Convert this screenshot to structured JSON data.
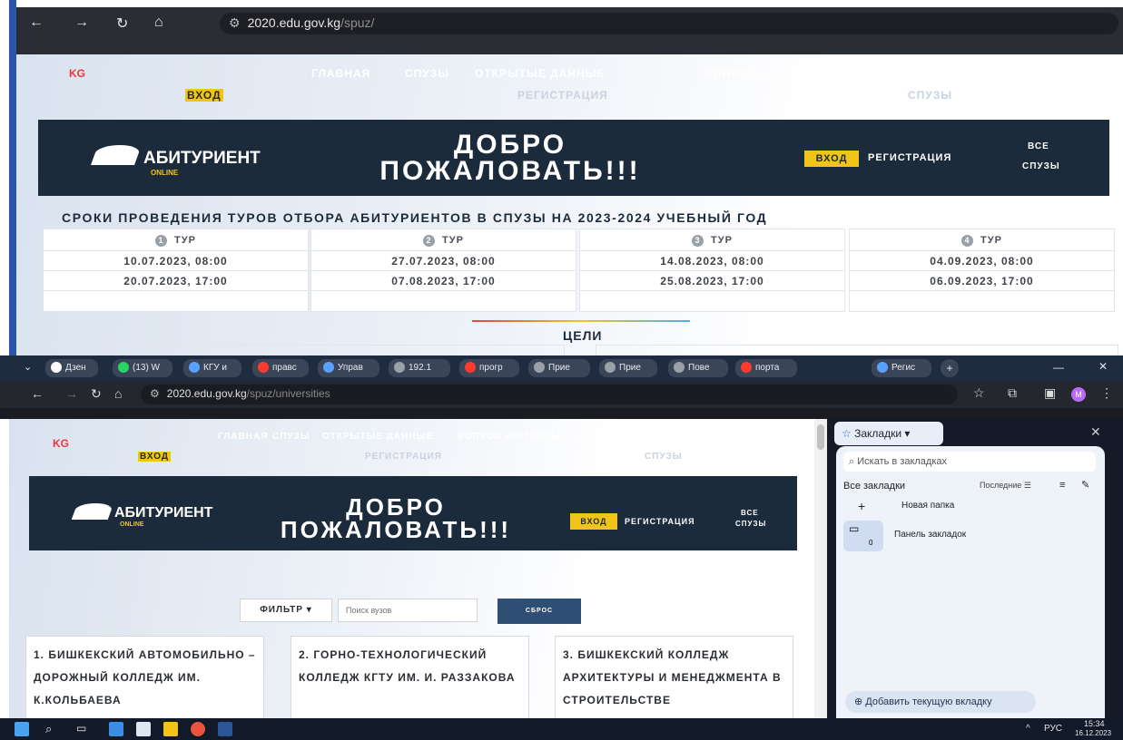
{
  "top": {
    "url_domain": "2020.edu.gov.kg",
    "url_path": "/spuz/",
    "brand": "KG",
    "nav": [
      "ГЛАВНАЯ",
      "СПУЗЫ",
      "ОТКРЫТЫЕ ДАННЫЕ",
      "ВОПРОСЫ/ОТВЕТЫ",
      "РЕГИСТРАЦИЯ",
      "ВХОД"
    ],
    "subnav": {
      "vhod": "ВХОД",
      "reg": "РЕГИСТРАЦИЯ",
      "spuzy": "СПУЗЫ"
    },
    "hero": {
      "logo": "АБИТУРИЕНТ",
      "logo_sub": "ONLINE",
      "welcome_1": "ДОБРО",
      "welcome_2": "ПОЖАЛОВАТЬ!!!",
      "btn_vhod": "ВХОД",
      "link_reg": "РЕГИСТРАЦИЯ",
      "link_all_1": "ВСЕ",
      "link_all_2": "СПУЗЫ"
    },
    "section_title": "СРОКИ ПРОВЕДЕНИЯ ТУРОВ ОТБОРА АБИТУРИЕНТОВ В СПУЗЫ НА 2023-2024 УЧЕБНЫЙ ГОД",
    "tours": [
      {
        "num": "1",
        "label": "ТУР",
        "start": "10.07.2023, 08:00",
        "end": "20.07.2023, 17:00"
      },
      {
        "num": "2",
        "label": "ТУР",
        "start": "27.07.2023, 08:00",
        "end": "07.08.2023, 17:00"
      },
      {
        "num": "3",
        "label": "ТУР",
        "start": "14.08.2023, 08:00",
        "end": "25.08.2023, 17:00"
      },
      {
        "num": "4",
        "label": "ТУР",
        "start": "04.09.2023, 08:00",
        "end": "06.09.2023, 17:00"
      }
    ],
    "goals": "ЦЕЛИ"
  },
  "tabs": [
    {
      "label": "Дзен",
      "color": "#ffffff"
    },
    {
      "label": "(13) W",
      "color": "#25d366"
    },
    {
      "label": "КГУ и",
      "color": "#5aa0ff"
    },
    {
      "label": "правс",
      "color": "#ff3b30"
    },
    {
      "label": "Управ",
      "color": "#5aa0ff"
    },
    {
      "label": "192.1",
      "color": "#9aa0a8"
    },
    {
      "label": "прогр",
      "color": "#ff3b30"
    },
    {
      "label": "Прие",
      "color": "#9aa0a8"
    },
    {
      "label": "Прие",
      "color": "#9aa0a8"
    },
    {
      "label": "Пове",
      "color": "#9aa0a8"
    },
    {
      "label": "порта",
      "color": "#ff3b30"
    },
    {
      "label": "Регис",
      "color": "#5aa0ff"
    }
  ],
  "bottom": {
    "url_domain": "2020.edu.gov.kg",
    "url_path": "/spuz/universities",
    "brand": "KG",
    "nav": [
      "ГЛАВНАЯ",
      "СПУЗЫ",
      "ОТКРЫТЫЕ ДАННЫЕ",
      "ВОПРОСЫ/ОТВЕТЫ",
      "РЕГИСТРАЦИЯ",
      "ВХОД"
    ],
    "subnav": {
      "vhod": "ВХОД",
      "reg": "РЕГИСТРАЦИЯ",
      "spuzy": "СПУЗЫ"
    },
    "filter_label": "ФИЛЬТР",
    "search_placeholder": "Поиск вузов",
    "reset_label": "СБРОС",
    "universities": [
      "1. БИШКЕКСКИЙ АВТОМОБИЛЬНО – ДОРОЖНЫЙ КОЛЛЕДЖ ИМ. К.КОЛЬБАЕВА",
      "2. ГОРНО-ТЕХНОЛОГИЧЕСКИЙ КОЛЛЕДЖ КГТУ ИМ. И. РАЗЗАКОВА",
      "3. БИШКЕКСКИЙ КОЛЛЕДЖ АРХИТЕКТУРЫ И МЕНЕДЖМЕНТА В СТРОИТЕЛЬСТВЕ"
    ]
  },
  "bookmarks": {
    "button": "Закладки",
    "search_placeholder": "Искать в закладках",
    "all": "Все закладки",
    "sort": "Последние",
    "new_folder": "Новая папка",
    "panel": "Панель закладок",
    "panel_count": "0",
    "add_tab": "Добавить текущую вкладку"
  },
  "taskbar": {
    "lang": "РУС",
    "time": "15:34",
    "date": "16.12.2023"
  },
  "colors": {
    "hero_bg": "#1c2b3b",
    "accent_yellow": "#f0c419",
    "brand_red": "#e83a3a",
    "reset_btn": "#2f4e74"
  }
}
